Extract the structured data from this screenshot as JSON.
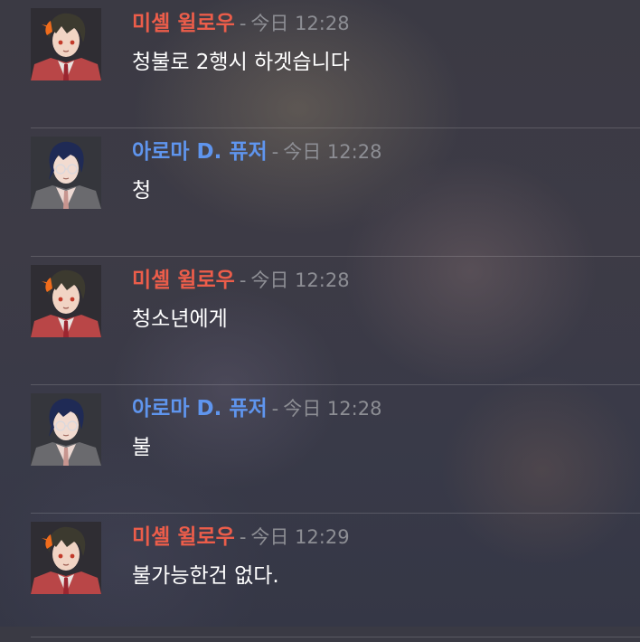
{
  "colors": {
    "michelle": "#ec5d4a",
    "aroma": "#5f95ee"
  },
  "messages": [
    {
      "author": "미셸 윌로우",
      "author_key": "michelle",
      "avatar": "red-jacket-dark-hair-avatar",
      "separator": "-",
      "timestamp": "今日 12:28",
      "content": "청불로 2행시 하겟습니다"
    },
    {
      "author": "아로마 D. 퓨저",
      "author_key": "aroma",
      "avatar": "glasses-blue-hair-avatar",
      "separator": "-",
      "timestamp": "今日 12:28",
      "content": "청"
    },
    {
      "author": "미셸 윌로우",
      "author_key": "michelle",
      "avatar": "red-jacket-dark-hair-avatar",
      "separator": "-",
      "timestamp": "今日 12:28",
      "content": "청소년에게"
    },
    {
      "author": "아로마 D. 퓨저",
      "author_key": "aroma",
      "avatar": "glasses-blue-hair-avatar",
      "separator": "-",
      "timestamp": "今日 12:28",
      "content": "불"
    },
    {
      "author": "미셸 윌로우",
      "author_key": "michelle",
      "avatar": "red-jacket-dark-hair-avatar",
      "separator": "-",
      "timestamp": "今日 12:29",
      "content": "불가능한건 없다."
    }
  ]
}
